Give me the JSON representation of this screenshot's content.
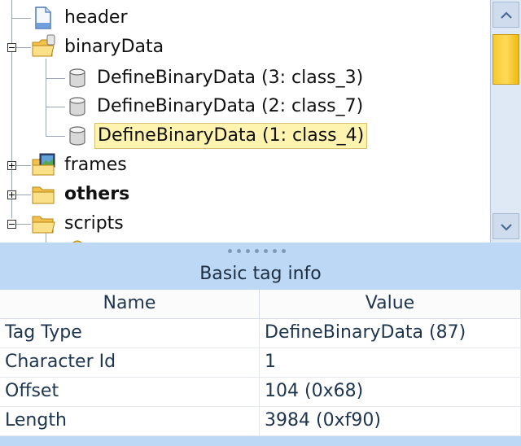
{
  "tree": {
    "items": [
      {
        "label": "header",
        "icon": "file-icon",
        "expanded": null
      },
      {
        "label": "binaryData",
        "icon": "folder-open-icon",
        "expanded": true
      },
      {
        "label": "DefineBinaryData (3: class_3)",
        "icon": "binary-data-icon"
      },
      {
        "label": "DefineBinaryData (2: class_7)",
        "icon": "binary-data-icon"
      },
      {
        "label": "DefineBinaryData (1: class_4)",
        "icon": "binary-data-icon",
        "selected": true
      },
      {
        "label": "frames",
        "icon": "frames-folder-icon",
        "expanded": false
      },
      {
        "label": "others",
        "icon": "folder-icon",
        "expanded": false,
        "bold": true
      },
      {
        "label": "scripts",
        "icon": "folder-open-icon",
        "expanded": true
      }
    ]
  },
  "panel": {
    "title": "Basic tag info",
    "columns": [
      "Name",
      "Value"
    ],
    "rows": [
      {
        "name": "Tag Type",
        "value": "DefineBinaryData (87)"
      },
      {
        "name": "Character Id",
        "value": "1"
      },
      {
        "name": "Offset",
        "value": "104 (0x68)"
      },
      {
        "name": "Length",
        "value": "3984 (0xf90)"
      }
    ]
  },
  "colors": {
    "selection_bg": "#fff3b0",
    "panel_bg": "#bcd8f4",
    "scroll_thumb": "#f7c92d"
  }
}
